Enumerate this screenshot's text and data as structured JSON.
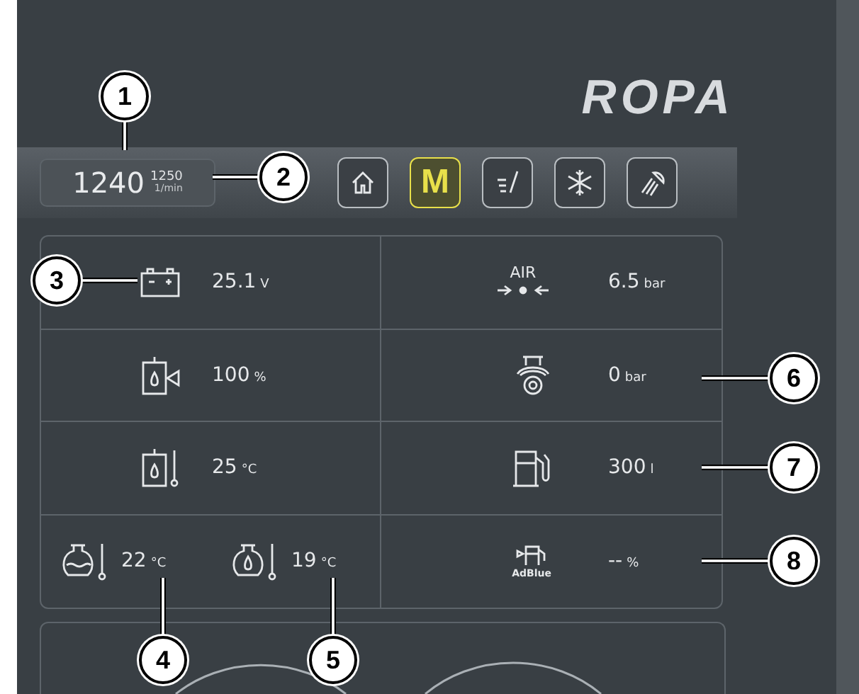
{
  "logo": "ROPA",
  "engine_speed": {
    "value": "1240",
    "setpoint": "1250",
    "unit": "1/min"
  },
  "mode_buttons": [
    {
      "kind": "home",
      "selected": false
    },
    {
      "kind": "letter",
      "label": "M",
      "selected": true
    },
    {
      "kind": "edit",
      "selected": false
    },
    {
      "kind": "snow",
      "selected": false
    },
    {
      "kind": "light",
      "selected": false
    }
  ],
  "readings": [
    {
      "cells": [
        {
          "kind": "battery",
          "value": "25.1",
          "unit": "V"
        }
      ]
    },
    {
      "cells": [
        {
          "kind": "air",
          "icon_label": "AIR",
          "value": "6.5",
          "unit": "bar"
        }
      ]
    },
    {
      "cells": [
        {
          "kind": "tank-level",
          "value": "100",
          "unit": "%"
        }
      ]
    },
    {
      "cells": [
        {
          "kind": "pump",
          "value": "0",
          "unit": "bar"
        }
      ]
    },
    {
      "cells": [
        {
          "kind": "tank-temp",
          "value": "25",
          "unit": "°C"
        }
      ]
    },
    {
      "cells": [
        {
          "kind": "fuel",
          "value": "300",
          "unit": "l"
        }
      ]
    },
    {
      "cells": [
        {
          "kind": "coolant-temp",
          "value": "22",
          "unit": "°C"
        },
        {
          "kind": "oil-temp",
          "value": "19",
          "unit": "°C"
        }
      ]
    },
    {
      "cells": [
        {
          "kind": "adblue",
          "icon_label": "AdBlue",
          "value": "--",
          "unit": "%"
        }
      ]
    }
  ],
  "callouts": [
    "1",
    "2",
    "3",
    "4",
    "5",
    "6",
    "7",
    "8"
  ]
}
